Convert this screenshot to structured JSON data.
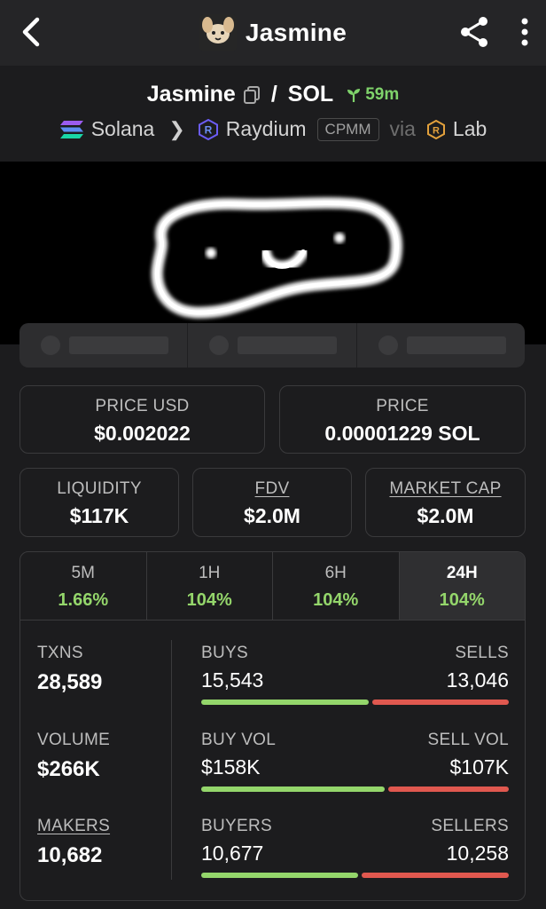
{
  "header": {
    "title": "Jasmine"
  },
  "pair": {
    "base": "Jasmine",
    "separator": "/",
    "quote": "SOL",
    "age": "59m",
    "chain": "Solana",
    "dex": "Raydium",
    "pool_type": "CPMM",
    "via": "via",
    "launchpad": "Lab"
  },
  "prices": {
    "price_usd_label": "PRICE USD",
    "price_usd": "$0.002022",
    "price_label": "PRICE",
    "price_native": "0.00001229 SOL"
  },
  "metrics": {
    "liquidity_label": "LIQUIDITY",
    "liquidity": "$117K",
    "fdv_label": "FDV",
    "fdv": "$2.0M",
    "mcap_label": "MARKET CAP",
    "mcap": "$2.0M"
  },
  "periods": [
    {
      "label": "5M",
      "change": "1.66%",
      "active": false
    },
    {
      "label": "1H",
      "change": "104%",
      "active": false
    },
    {
      "label": "6H",
      "change": "104%",
      "active": false
    },
    {
      "label": "24H",
      "change": "104%",
      "active": true
    }
  ],
  "stats": {
    "txns_label": "TXNS",
    "txns": "28,589",
    "buys_label": "BUYS",
    "buys": "15,543",
    "sells_label": "SELLS",
    "sells": "13,046",
    "buys_ratio": 0.544,
    "volume_label": "VOLUME",
    "volume": "$266K",
    "buy_vol_label": "BUY VOL",
    "buy_vol": "$158K",
    "sell_vol_label": "SELL VOL",
    "sell_vol": "$107K",
    "buy_vol_ratio": 0.596,
    "makers_label": "MAKERS",
    "makers": "10,682",
    "buyers_label": "BUYERS",
    "buyers": "10,677",
    "sellers_label": "SELLERS",
    "sellers": "10,258",
    "buyers_ratio": 0.51
  },
  "colors": {
    "positive": "#94d66b",
    "negative": "#e0584f",
    "background": "#1c1c1e"
  }
}
